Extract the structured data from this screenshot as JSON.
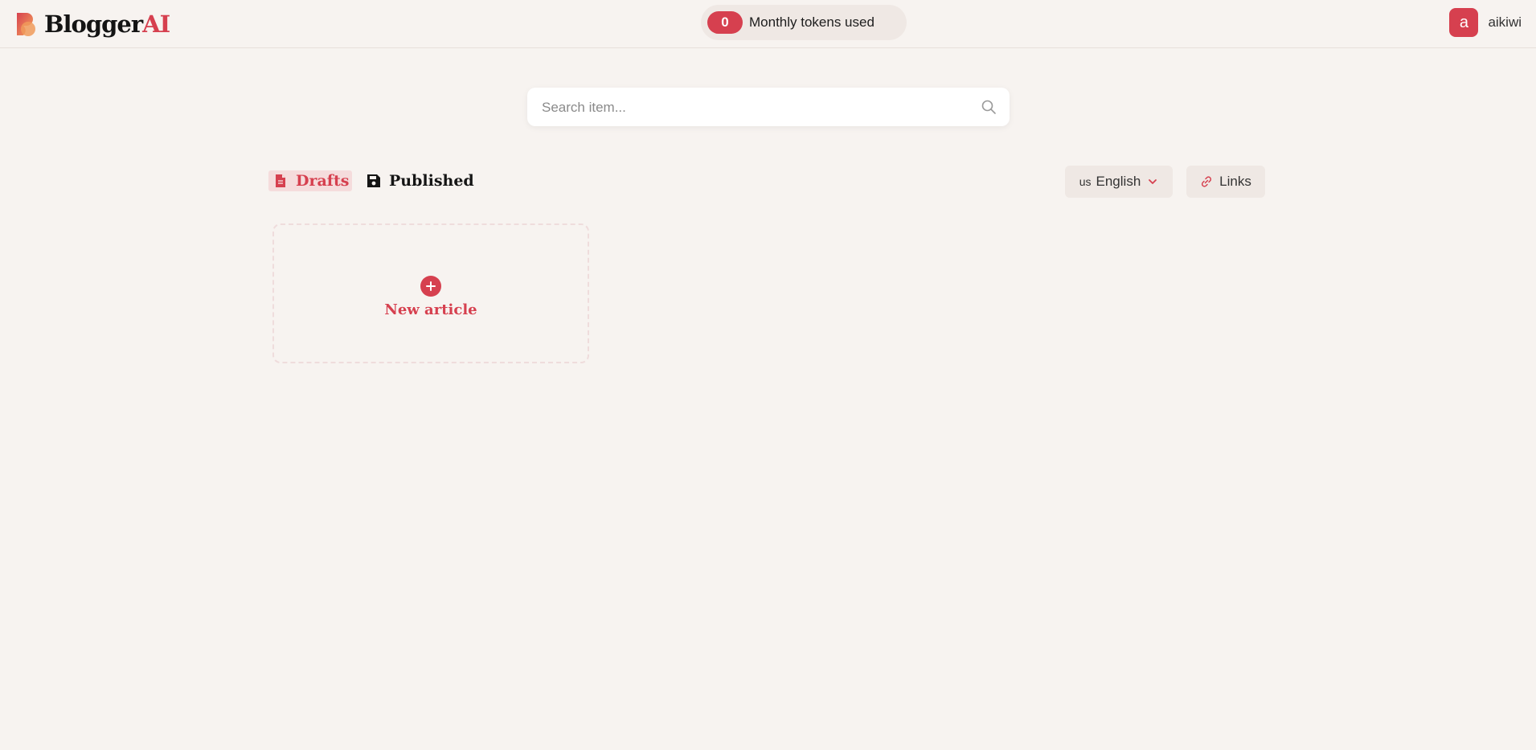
{
  "brand": {
    "name_main": "Blogger",
    "name_accent": "AI",
    "accent_color": "#d6404f"
  },
  "tokens": {
    "count": "0",
    "label": "Monthly tokens used"
  },
  "user": {
    "avatar_letter": "a",
    "name": "aikiwi"
  },
  "search": {
    "placeholder": "Search item...",
    "value": ""
  },
  "tabs": [
    {
      "label": "Drafts",
      "icon": "document-icon",
      "active": true
    },
    {
      "label": "Published",
      "icon": "save-icon",
      "active": false
    }
  ],
  "language": {
    "flag": "us",
    "selected": "English"
  },
  "links_button": {
    "label": "Links"
  },
  "new_article": {
    "label": "New article"
  },
  "colors": {
    "background": "#f7f3f0",
    "accent": "#d6404f",
    "control_bg": "#efe8e4"
  }
}
